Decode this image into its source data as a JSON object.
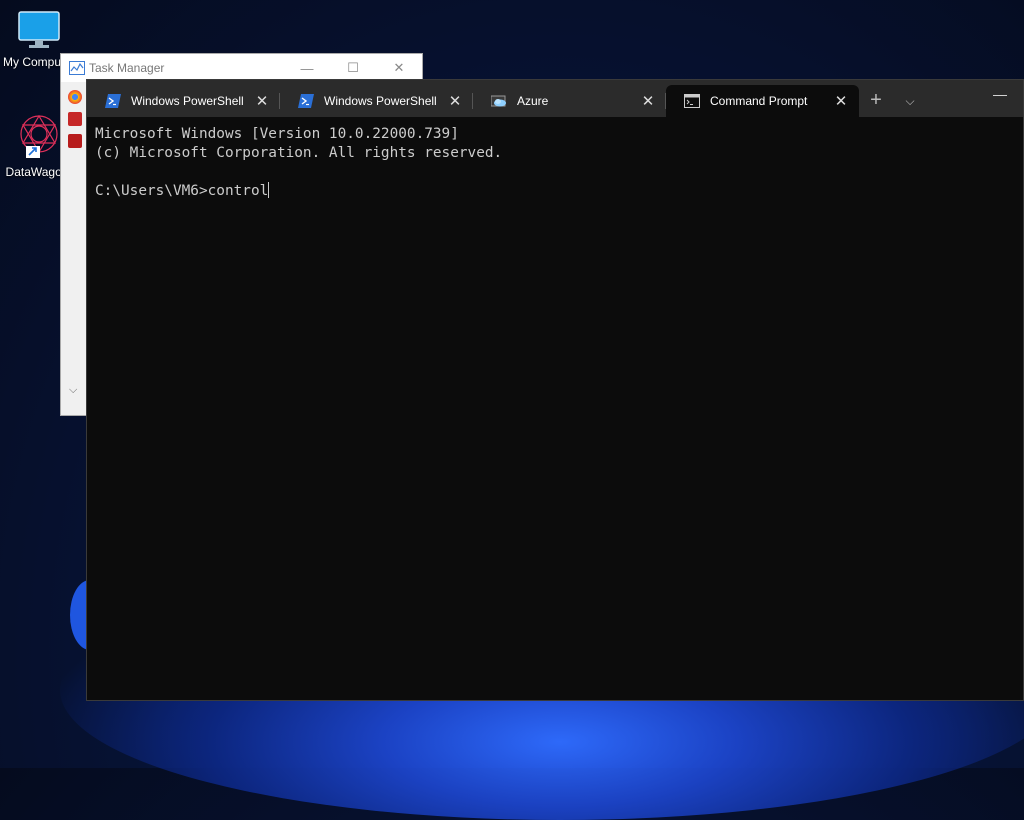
{
  "desktop": {
    "icons": [
      {
        "label": "My Computer"
      },
      {
        "label": "DataWagon"
      }
    ]
  },
  "task_manager": {
    "title": "Task Manager",
    "minimize": "—",
    "maximize": "☐",
    "close": "✕"
  },
  "terminal": {
    "tabs": [
      {
        "label": "Windows PowerShell",
        "icon": "powershell-icon",
        "close": "✕"
      },
      {
        "label": "Windows PowerShell",
        "icon": "powershell-icon",
        "close": "✕"
      },
      {
        "label": "Azure",
        "icon": "azure-cloud-icon",
        "close": "✕"
      },
      {
        "label": "Command Prompt",
        "icon": "cmd-icon",
        "close": "✕",
        "active": true
      }
    ],
    "new_tab": "+",
    "dropdown": "⌵",
    "minimize": "—",
    "console_lines": [
      "Microsoft Windows [Version 10.0.22000.739]",
      "(c) Microsoft Corporation. All rights reserved.",
      "",
      "C:\\Users\\VM6>control"
    ],
    "colors": {
      "background": "#0c0c0c",
      "text": "#cccccc",
      "tabbar": "#2b2b2b"
    }
  }
}
